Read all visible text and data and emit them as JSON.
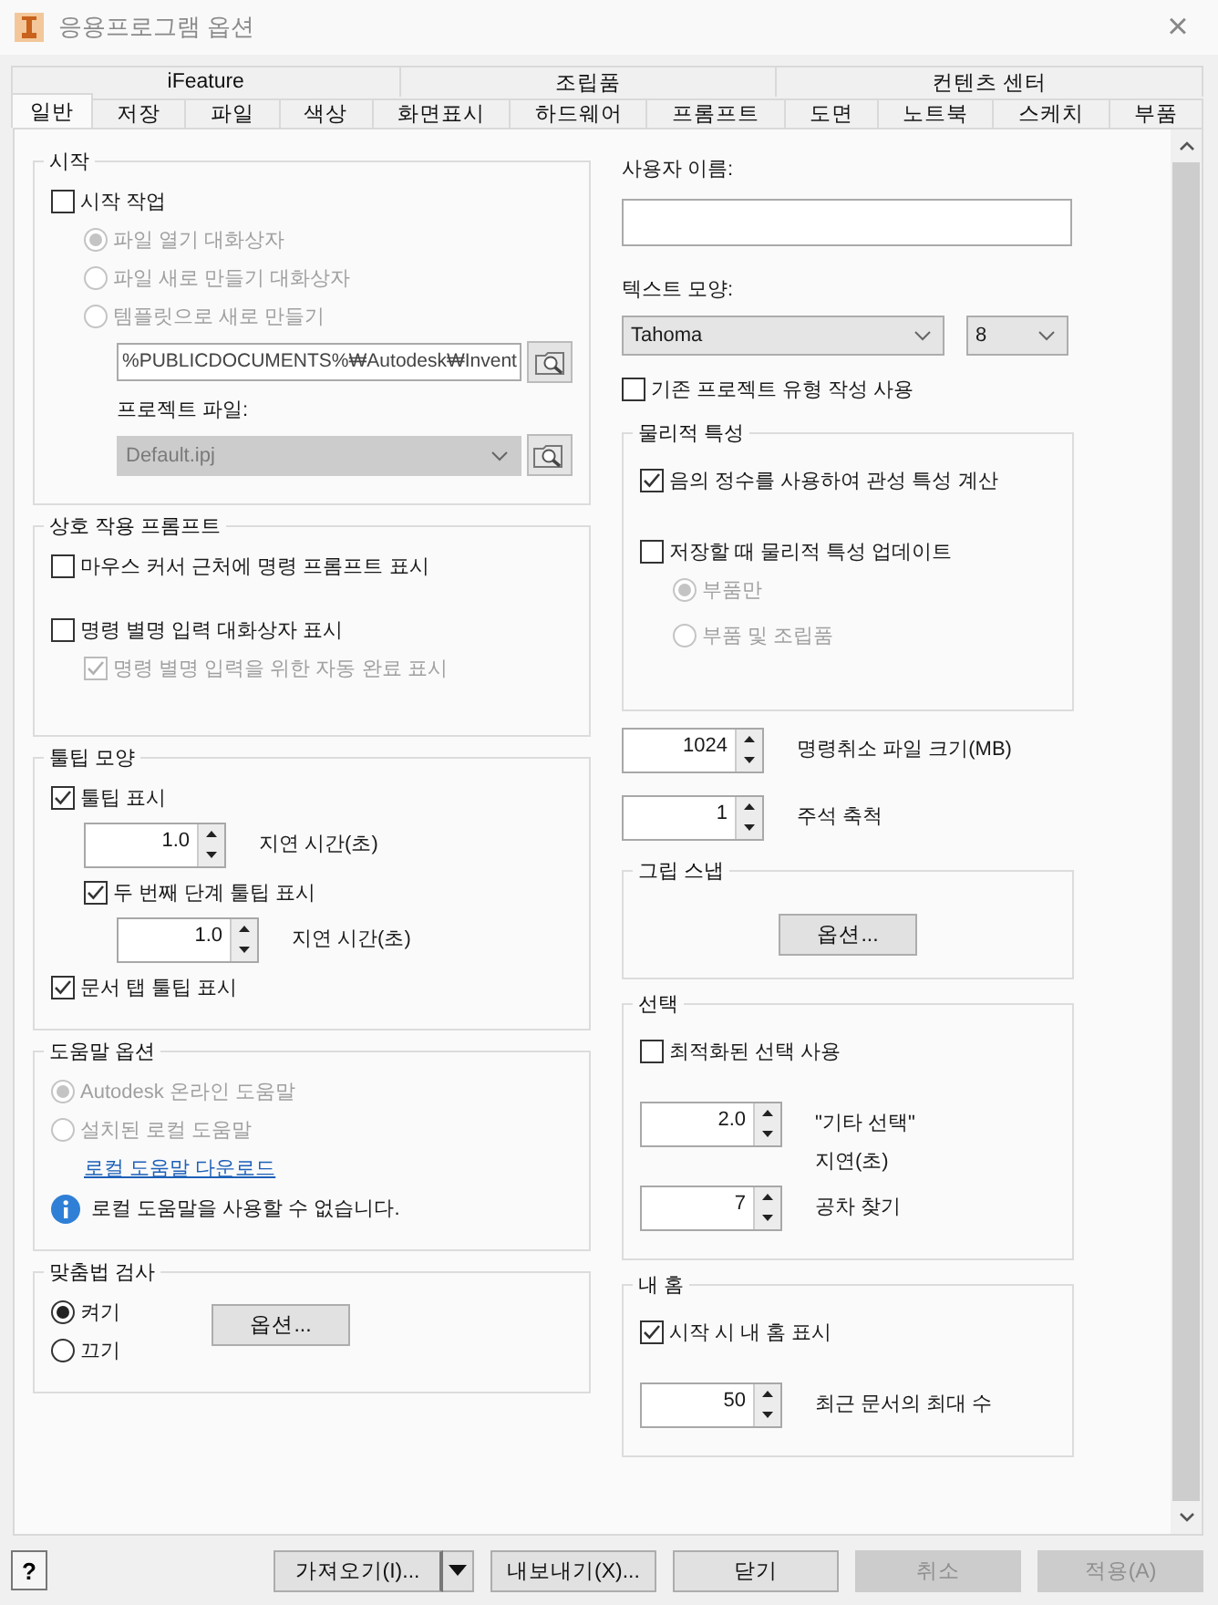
{
  "window": {
    "title": "응용프로그램 옵션",
    "close": "×"
  },
  "tabs_upper": [
    {
      "label": "iFeature",
      "selected": false
    },
    {
      "label": "조립품",
      "selected": false
    },
    {
      "label": "컨텐츠 센터",
      "selected": false
    }
  ],
  "tabs": [
    {
      "label": "일반",
      "selected": true
    },
    {
      "label": "저장",
      "selected": false
    },
    {
      "label": "파일",
      "selected": false
    },
    {
      "label": "색상",
      "selected": false
    },
    {
      "label": "화면표시",
      "selected": false
    },
    {
      "label": "하드웨어",
      "selected": false
    },
    {
      "label": "프롬프트",
      "selected": false
    },
    {
      "label": "도면",
      "selected": false
    },
    {
      "label": "노트북",
      "selected": false
    },
    {
      "label": "스케치",
      "selected": false
    },
    {
      "label": "부품",
      "selected": false
    }
  ],
  "columns": [
    {
      "items": [
        {
          "kind": "group",
          "title": "시작",
          "items": [
            {
              "kind": "checkbox",
              "label": "시작 작업",
              "checked": false,
              "disabled": false,
              "children": [
                {
                  "kind": "radio",
                  "label": "파일 열기 대화상자",
                  "selected": true,
                  "disabled": true
                },
                {
                  "kind": "radio",
                  "label": "파일 새로 만들기 대화상자",
                  "selected": false,
                  "disabled": true
                },
                {
                  "kind": "radio",
                  "label": "템플릿으로 새로 만들기",
                  "selected": false,
                  "disabled": true,
                  "children": [
                    {
                      "kind": "path_browse",
                      "value": "%PUBLICDOCUMENTS%₩Autodesk₩Invent"
                    },
                    {
                      "kind": "label",
                      "label": "프로젝트 파일:"
                    },
                    {
                      "kind": "combo_browse",
                      "value": "Default.ipj",
                      "disabled": true
                    }
                  ]
                }
              ]
            }
          ]
        },
        {
          "kind": "group",
          "title": "상호 작용 프롬프트",
          "items": [
            {
              "kind": "checkbox",
              "label": "마우스 커서 근처에 명령 프롬프트 표시",
              "checked": false,
              "disabled": false
            },
            {
              "kind": "checkbox",
              "label": "명령 별명 입력 대화상자 표시",
              "checked": false,
              "disabled": false,
              "children": [
                {
                  "kind": "checkbox",
                  "label": "명령 별명 입력을 위한 자동 완료 표시",
                  "checked": true,
                  "disabled": true
                }
              ]
            }
          ]
        },
        {
          "kind": "group",
          "title": "툴팁 모양",
          "items": [
            {
              "kind": "checkbox",
              "label": "툴팁 표시",
              "checked": true,
              "disabled": false,
              "children": [
                {
                  "kind": "spin",
                  "value": "1.0",
                  "lines": [
                    "지연 시간(초)"
                  ]
                },
                {
                  "kind": "checkbox",
                  "label": "두 번째 단계 툴팁 표시",
                  "checked": true,
                  "disabled": false,
                  "children": [
                    {
                      "kind": "spin",
                      "value": "1.0",
                      "lines": [
                        "지연 시간(초)"
                      ]
                    }
                  ]
                }
              ]
            },
            {
              "kind": "checkbox",
              "label": "문서 탭 툴팁 표시",
              "checked": true,
              "disabled": false
            }
          ]
        },
        {
          "kind": "group",
          "title": "도움말 옵션",
          "items": [
            {
              "kind": "radio",
              "label": "Autodesk 온라인 도움말",
              "selected": true,
              "disabled": true
            },
            {
              "kind": "radio",
              "label": "설치된 로컬 도움말",
              "selected": false,
              "disabled": true,
              "children": [
                {
                  "kind": "link",
                  "label": "로컬 도움말 다운로드"
                }
              ]
            },
            {
              "kind": "info",
              "label": "로컬 도움말을 사용할 수 없습니다."
            }
          ]
        },
        {
          "kind": "group",
          "title": "맞춤법 검사",
          "button": "옵션...",
          "items": [
            {
              "kind": "radio",
              "label": "켜기",
              "selected": true,
              "disabled": false
            },
            {
              "kind": "radio",
              "label": "끄기",
              "selected": false,
              "disabled": false
            }
          ]
        }
      ]
    },
    {
      "items": [
        {
          "kind": "label",
          "label": "사용자 이름:"
        },
        {
          "kind": "text_field"
        },
        {
          "kind": "label",
          "label": "텍스트 모양:"
        },
        {
          "kind": "combo_row",
          "combos": [
            {
              "value": "Tahoma"
            },
            {
              "value": "8"
            }
          ]
        },
        {
          "kind": "checkbox",
          "label": "기존 프로젝트 유형 작성 사용",
          "checked": false,
          "disabled": false
        },
        {
          "kind": "group",
          "title": "물리적 특성",
          "items": [
            {
              "kind": "checkbox",
              "label": "음의 정수를 사용하여 관성 특성 계산",
              "checked": true,
              "disabled": false
            },
            {
              "kind": "checkbox",
              "label": "저장할 때 물리적 특성 업데이트",
              "checked": false,
              "disabled": false,
              "children": [
                {
                  "kind": "radio",
                  "label": "부품만",
                  "selected": true,
                  "disabled": true
                },
                {
                  "kind": "radio",
                  "label": "부품 및 조립품",
                  "selected": false,
                  "disabled": true
                }
              ]
            }
          ]
        },
        {
          "kind": "spin",
          "value": "1024",
          "lines": [
            "명령취소 파일 크기(MB)"
          ]
        },
        {
          "kind": "spin",
          "value": "1",
          "lines": [
            "주석 축척"
          ]
        },
        {
          "kind": "group",
          "title": "그립 스냅",
          "button": "옵션..."
        },
        {
          "kind": "group",
          "title": "선택",
          "items": [
            {
              "kind": "checkbox",
              "label": "최적화된 선택 사용",
              "checked": false,
              "disabled": false
            },
            {
              "kind": "spin",
              "value": "2.0",
              "lines": [
                "\"기타 선택\"",
                "지연(초)"
              ]
            },
            {
              "kind": "spin",
              "value": "7",
              "lines": [
                "공차 찾기"
              ]
            }
          ]
        },
        {
          "kind": "group",
          "title": "내 홈",
          "items": [
            {
              "kind": "checkbox",
              "label": "시작 시 내 홈 표시",
              "checked": true,
              "disabled": false
            },
            {
              "kind": "spin",
              "value": "50",
              "lines": [
                "최근 문서의 최대 수"
              ]
            }
          ]
        }
      ]
    }
  ],
  "footer": {
    "help": "?",
    "buttons": [
      {
        "kind": "split",
        "label": "가져오기(I)...",
        "disabled": false
      },
      {
        "kind": "plain",
        "label": "내보내기(X)...",
        "disabled": false
      },
      {
        "kind": "plain",
        "label": "닫기",
        "disabled": false
      },
      {
        "kind": "plain",
        "label": "취소",
        "disabled": true
      },
      {
        "kind": "plain",
        "label": "적용(A)",
        "disabled": true
      }
    ]
  }
}
